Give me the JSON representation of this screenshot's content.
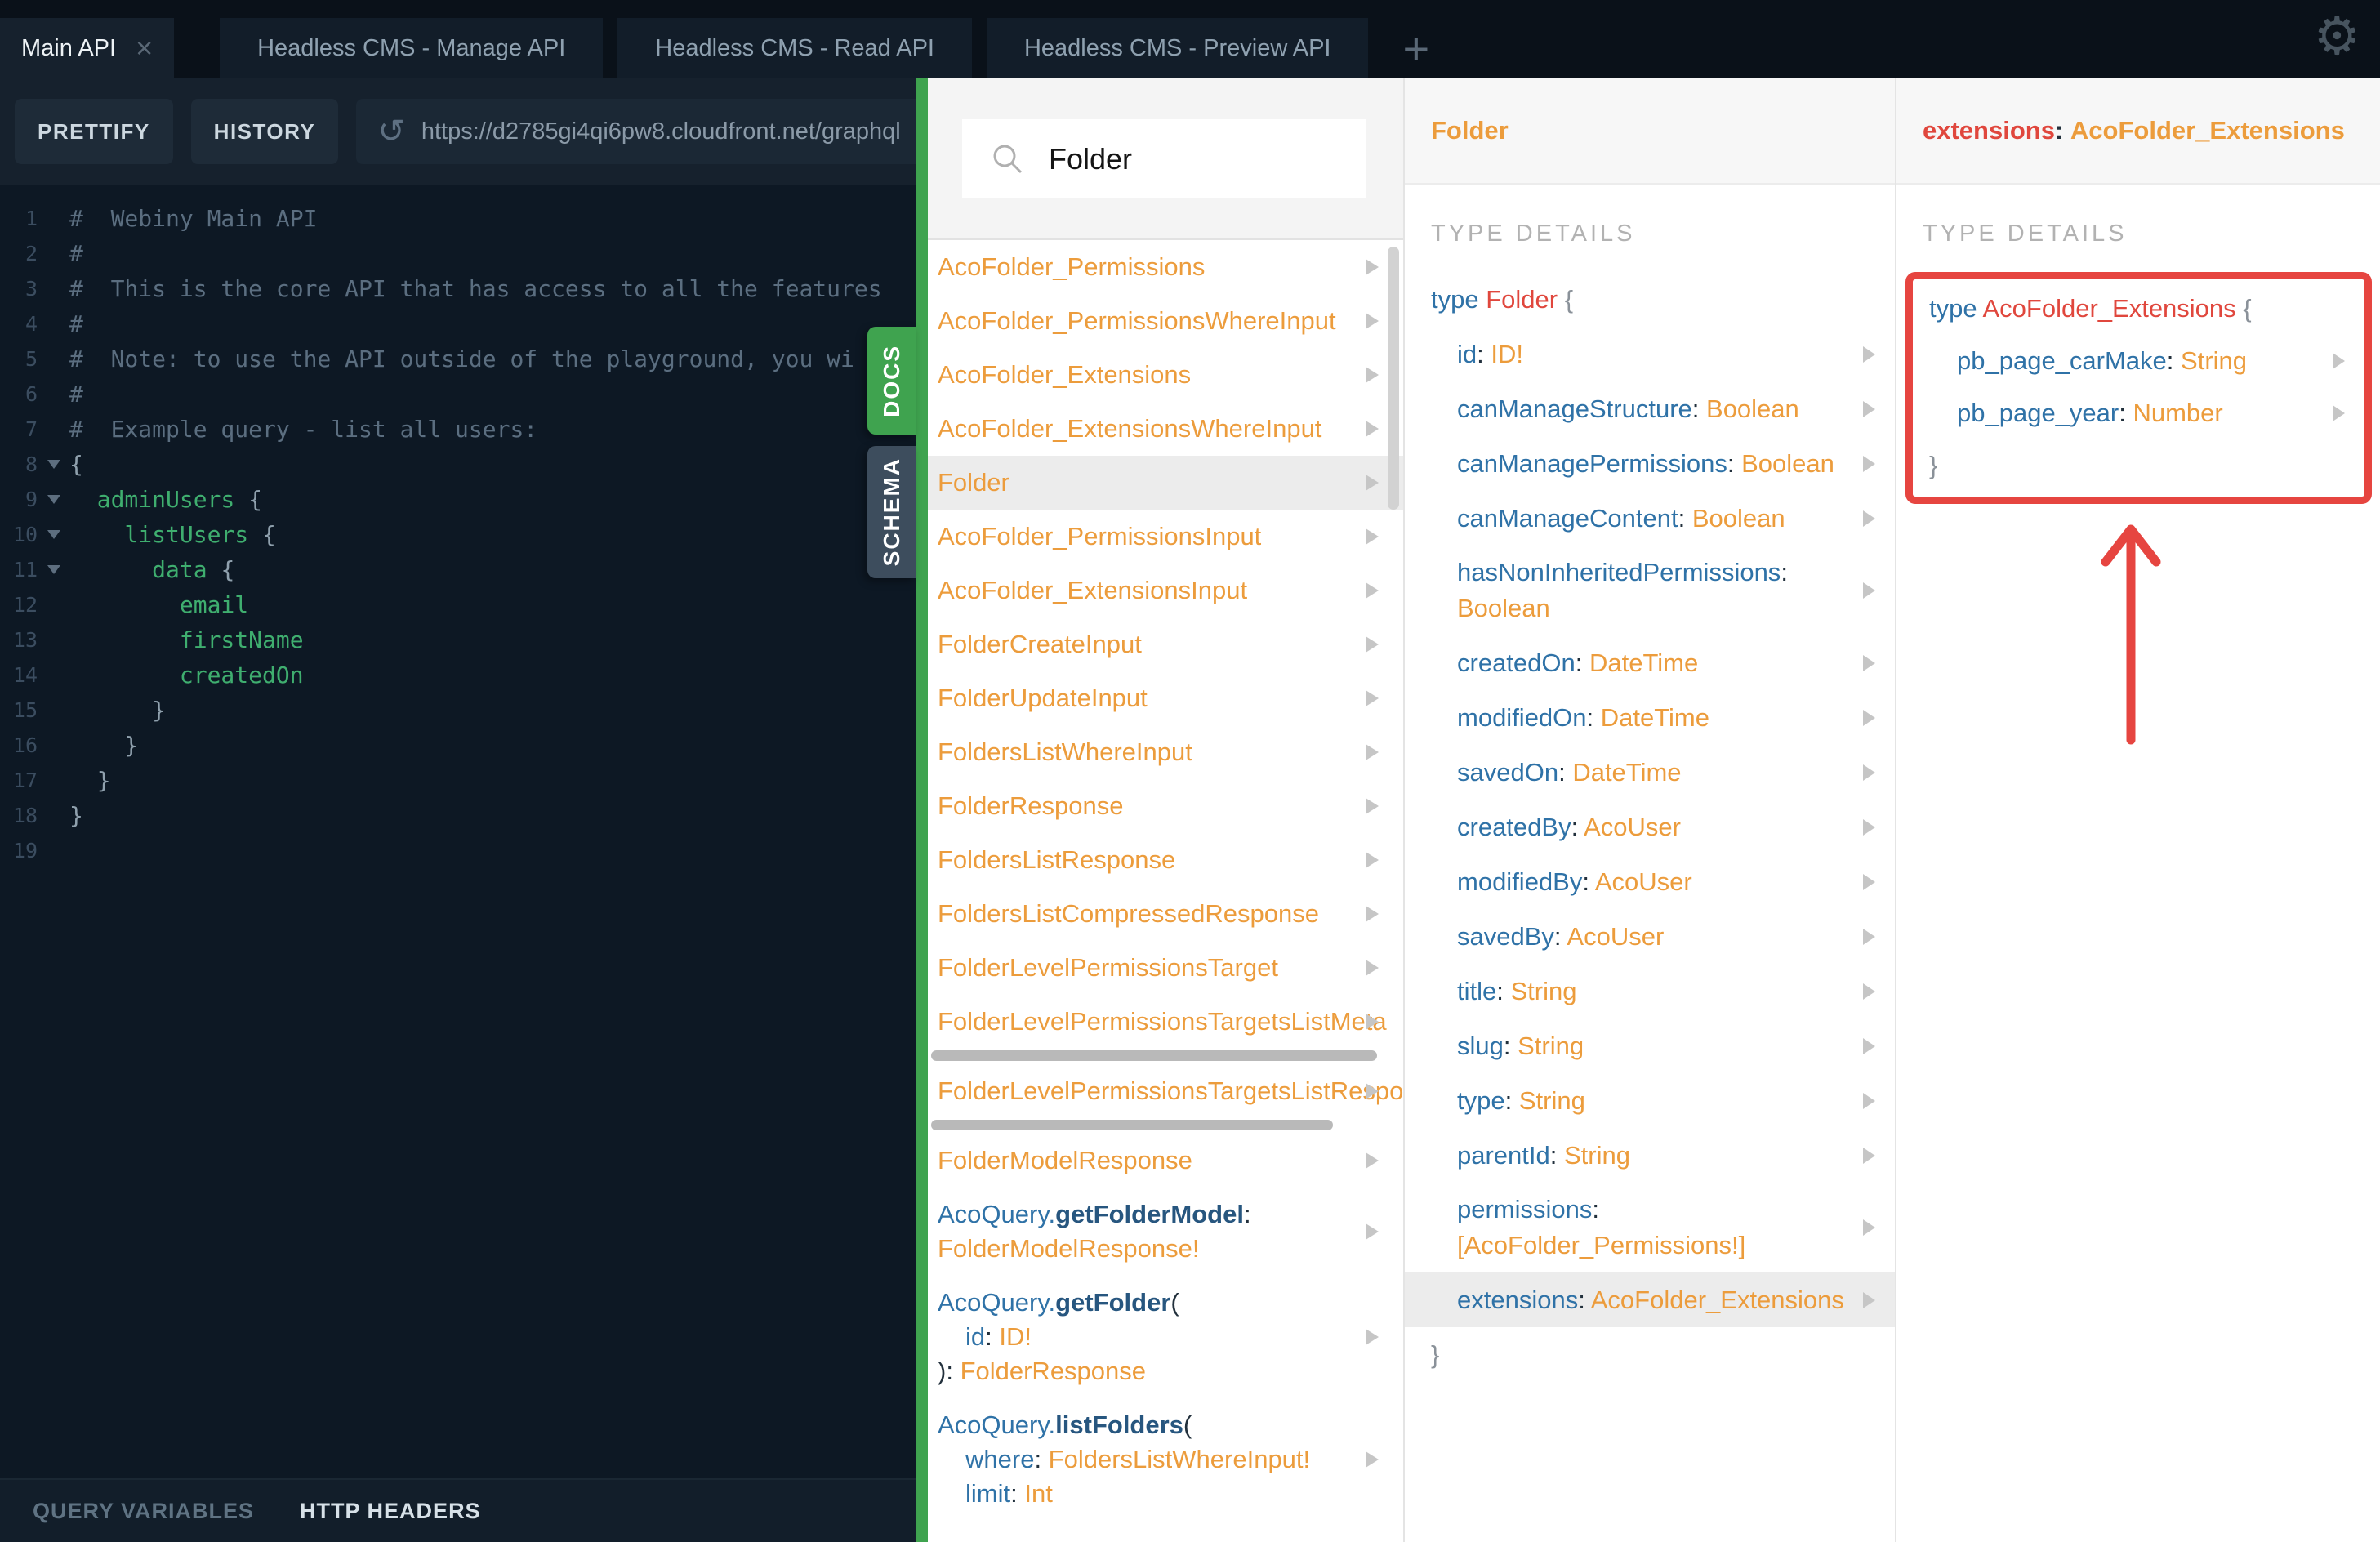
{
  "topbar": {
    "tabs": [
      {
        "label": "Main API",
        "active": true,
        "closable": true
      },
      {
        "label": "Headless CMS - Manage API",
        "active": false
      },
      {
        "label": "Headless CMS - Read API",
        "active": false
      },
      {
        "label": "Headless CMS - Preview API",
        "active": false
      }
    ],
    "new_tab_label": "+",
    "close_icon": "×",
    "gear_icon": "⚙"
  },
  "toolbar": {
    "prettify_label": "PRETTIFY",
    "history_label": "HISTORY",
    "replay_icon": "↺",
    "url": "https://d2785gi4qi6pw8.cloudfront.net/graphql"
  },
  "editor": {
    "lines": [
      {
        "n": 1,
        "fold": false,
        "tokens": [
          [
            "#  Webiny Main API",
            "cm"
          ]
        ]
      },
      {
        "n": 2,
        "fold": false,
        "tokens": [
          [
            "#",
            "cm"
          ]
        ]
      },
      {
        "n": 3,
        "fold": false,
        "tokens": [
          [
            "#  This is the core API that has access to all the features",
            "cm"
          ]
        ]
      },
      {
        "n": 4,
        "fold": false,
        "tokens": [
          [
            "#",
            "cm"
          ]
        ]
      },
      {
        "n": 5,
        "fold": false,
        "tokens": [
          [
            "#  Note: to use the API outside of the playground, you wi",
            "cm"
          ]
        ]
      },
      {
        "n": 6,
        "fold": false,
        "tokens": [
          [
            "#",
            "cm"
          ]
        ]
      },
      {
        "n": 7,
        "fold": false,
        "tokens": [
          [
            "#  Example query - list all users:",
            "cm"
          ]
        ]
      },
      {
        "n": 8,
        "fold": true,
        "tokens": [
          [
            "{",
            "pu"
          ]
        ]
      },
      {
        "n": 9,
        "fold": true,
        "tokens": [
          [
            "  ",
            "pl"
          ],
          [
            "adminUsers",
            "gr"
          ],
          [
            " {",
            "pu"
          ]
        ]
      },
      {
        "n": 10,
        "fold": true,
        "tokens": [
          [
            "    ",
            "pl"
          ],
          [
            "listUsers",
            "gr"
          ],
          [
            " {",
            "pu"
          ]
        ]
      },
      {
        "n": 11,
        "fold": true,
        "tokens": [
          [
            "      ",
            "pl"
          ],
          [
            "data",
            "gr"
          ],
          [
            " {",
            "pu"
          ]
        ]
      },
      {
        "n": 12,
        "fold": false,
        "tokens": [
          [
            "        ",
            "pl"
          ],
          [
            "email",
            "gr"
          ]
        ]
      },
      {
        "n": 13,
        "fold": false,
        "tokens": [
          [
            "        ",
            "pl"
          ],
          [
            "firstName",
            "gr"
          ]
        ]
      },
      {
        "n": 14,
        "fold": false,
        "tokens": [
          [
            "        ",
            "pl"
          ],
          [
            "createdOn",
            "gr"
          ]
        ]
      },
      {
        "n": 15,
        "fold": false,
        "tokens": [
          [
            "      }",
            "pu"
          ]
        ]
      },
      {
        "n": 16,
        "fold": false,
        "tokens": [
          [
            "    }",
            "pu"
          ]
        ]
      },
      {
        "n": 17,
        "fold": false,
        "tokens": [
          [
            "  }",
            "pu"
          ]
        ]
      },
      {
        "n": 18,
        "fold": false,
        "tokens": [
          [
            "}",
            "pu"
          ]
        ]
      },
      {
        "n": 19,
        "fold": false,
        "tokens": []
      }
    ]
  },
  "side_tabs": {
    "docs_label": "DOCS",
    "schema_label": "SCHEMA"
  },
  "docs": {
    "search_value": "Folder",
    "items": [
      {
        "kind": "type",
        "label": "AcoFolder_Permissions"
      },
      {
        "kind": "type",
        "label": "AcoFolder_PermissionsWhereInput"
      },
      {
        "kind": "type",
        "label": "AcoFolder_Extensions"
      },
      {
        "kind": "type",
        "label": "AcoFolder_ExtensionsWhereInput"
      },
      {
        "kind": "type",
        "label": "Folder",
        "highlighted": true
      },
      {
        "kind": "type",
        "label": "AcoFolder_PermissionsInput"
      },
      {
        "kind": "type",
        "label": "AcoFolder_ExtensionsInput"
      },
      {
        "kind": "type",
        "label": "FolderCreateInput"
      },
      {
        "kind": "type",
        "label": "FolderUpdateInput"
      },
      {
        "kind": "type",
        "label": "FoldersListWhereInput"
      },
      {
        "kind": "type",
        "label": "FolderResponse"
      },
      {
        "kind": "type",
        "label": "FoldersListResponse"
      },
      {
        "kind": "type",
        "label": "FoldersListCompressedResponse"
      },
      {
        "kind": "type",
        "label": "FolderLevelPermissionsTarget"
      },
      {
        "kind": "type",
        "label": "FolderLevelPermissionsTargetsListMeta",
        "hscroll": true,
        "hscroll_w": 546
      },
      {
        "kind": "type",
        "label": "FolderLevelPermissionsTargetsListResponse",
        "hscroll": true,
        "hscroll_w": 492
      },
      {
        "kind": "type",
        "label": "FolderModelResponse"
      },
      {
        "kind": "query",
        "lines": [
          {
            "ind": false,
            "tokens": [
              [
                "AcoQuery.",
                "bl"
              ],
              [
                "getFolderModel",
                "bb"
              ],
              [
                ":",
                "dk"
              ]
            ]
          },
          {
            "ind": false,
            "tokens": [
              [
                "FolderModelResponse!",
                "or"
              ]
            ]
          }
        ]
      },
      {
        "kind": "query",
        "lines": [
          {
            "ind": false,
            "tokens": [
              [
                "AcoQuery.",
                "bl"
              ],
              [
                "getFolder",
                "bb"
              ],
              [
                "(",
                "dk"
              ]
            ]
          },
          {
            "ind": true,
            "tokens": [
              [
                "id",
                "bl"
              ],
              [
                ": ",
                "dk"
              ],
              [
                "ID!",
                "or"
              ]
            ]
          },
          {
            "ind": false,
            "tokens": [
              [
                "): ",
                "dk"
              ],
              [
                "FolderResponse",
                "or"
              ]
            ]
          }
        ]
      },
      {
        "kind": "query",
        "lines": [
          {
            "ind": false,
            "tokens": [
              [
                "AcoQuery.",
                "bl"
              ],
              [
                "listFolders",
                "bb"
              ],
              [
                "(",
                "dk"
              ]
            ]
          },
          {
            "ind": true,
            "tokens": [
              [
                "where",
                "bl"
              ],
              [
                ": ",
                "dk"
              ],
              [
                "FoldersListWhereInput!",
                "or"
              ]
            ]
          },
          {
            "ind": true,
            "tokens": [
              [
                "limit",
                "bl"
              ],
              [
                ": ",
                "dk"
              ],
              [
                "Int",
                "or"
              ]
            ]
          }
        ]
      }
    ]
  },
  "folder_panel": {
    "title": "Folder",
    "section_label": "TYPE DETAILS",
    "keyword": "type ",
    "type_name": "Folder ",
    "open_brace": "{",
    "close_brace": "}",
    "fields": [
      {
        "name": "id",
        "type": "ID!"
      },
      {
        "name": "canManageStructure",
        "type": "Boolean"
      },
      {
        "name": "canManagePermissions",
        "type": "Boolean"
      },
      {
        "name": "canManageContent",
        "type": "Boolean"
      },
      {
        "name": "hasNonInheritedPermissions",
        "type": "Boolean",
        "wrap": true
      },
      {
        "name": "createdOn",
        "type": "DateTime"
      },
      {
        "name": "modifiedOn",
        "type": "DateTime"
      },
      {
        "name": "savedOn",
        "type": "DateTime"
      },
      {
        "name": "createdBy",
        "type": "AcoUser"
      },
      {
        "name": "modifiedBy",
        "type": "AcoUser"
      },
      {
        "name": "savedBy",
        "type": "AcoUser"
      },
      {
        "name": "title",
        "type": "String"
      },
      {
        "name": "slug",
        "type": "String"
      },
      {
        "name": "type",
        "type": "String"
      },
      {
        "name": "parentId",
        "type": "String"
      },
      {
        "name": "permissions",
        "type": "[AcoFolder_Permissions!]",
        "wrap": true
      },
      {
        "name": "extensions",
        "type": "AcoFolder_Extensions",
        "highlighted": true
      }
    ]
  },
  "extensions_panel": {
    "title_field": "extensions",
    "title_sep": ": ",
    "title_type": "AcoFolder_Extensions",
    "section_label": "TYPE DETAILS",
    "keyword": "type ",
    "type_name": "AcoFolder_Extensions ",
    "open_brace": "{",
    "close_brace": "}",
    "fields": [
      {
        "name": "pb_page_carMake",
        "type": "String"
      },
      {
        "name": "pb_page_year",
        "type": "Number"
      }
    ]
  },
  "bottom_bar": {
    "query_variables_label": "QUERY VARIABLES",
    "http_headers_label": "HTTP HEADERS"
  },
  "colors": {
    "accent_green": "#3fa34f",
    "annotation_red": "#e64540",
    "type_orange": "#ec9c3c",
    "field_blue": "#2f72a7",
    "name_red": "#e0473d"
  }
}
